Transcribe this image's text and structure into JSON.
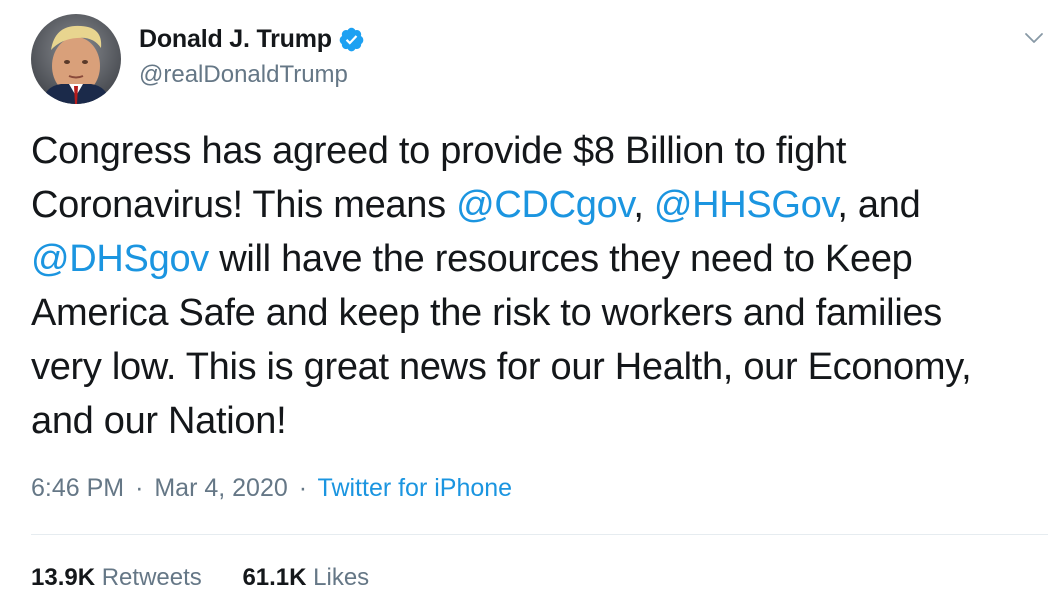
{
  "author": {
    "display_name": "Donald J. Trump",
    "handle": "@realDonaldTrump",
    "avatar_icon": "profile-photo",
    "verified_icon": "verified-badge-icon"
  },
  "menu_icon": "chevron-down-icon",
  "tweet": {
    "lines": [
      [
        {
          "t": "Congress has agreed to provide $8 Billion to fight"
        }
      ],
      [
        {
          "t": "Coronavirus! This means "
        },
        {
          "t": "@CDCgov",
          "m": true
        },
        {
          "t": ", "
        },
        {
          "t": "@HHSGov",
          "m": true
        },
        {
          "t": ", and"
        }
      ],
      [
        {
          "t": "@DHSgov",
          "m": true
        },
        {
          "t": " will have the resources they need to Keep"
        }
      ],
      [
        {
          "t": "America Safe and keep the risk to workers and families"
        }
      ],
      [
        {
          "t": "very low. This is great news for our Health, our Economy,"
        }
      ],
      [
        {
          "t": "and our Nation!"
        }
      ]
    ]
  },
  "meta": {
    "time": "6:46 PM",
    "separator": "·",
    "date": "Mar 4, 2020",
    "source": "Twitter for iPhone"
  },
  "stats": {
    "retweets_count": "13.9K",
    "retweets_label": "Retweets",
    "likes_count": "61.1K",
    "likes_label": "Likes"
  },
  "colors": {
    "link": "#1b95e0",
    "secondary_text": "#657786",
    "primary_text": "#14171a",
    "divider": "#e6ecf0"
  }
}
